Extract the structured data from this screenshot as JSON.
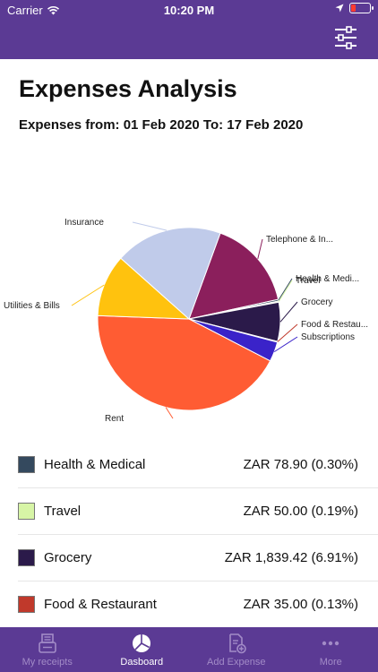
{
  "status_bar": {
    "carrier": "Carrier",
    "time": "10:20 PM"
  },
  "page": {
    "title": "Expenses Analysis",
    "subtitle": "Expenses from: 01 Feb 2020 To: 17 Feb 2020"
  },
  "chart_data": {
    "type": "pie",
    "slices": [
      {
        "label": "Telephone & In...",
        "value": 16.0,
        "color": "#8b1f5c"
      },
      {
        "label": "Health & Medi...",
        "value": 0.3,
        "color": "#34495e"
      },
      {
        "label": "Travel",
        "value": 0.19,
        "color": "#d7f5a6"
      },
      {
        "label": "Grocery",
        "value": 6.91,
        "color": "#2b1a4a"
      },
      {
        "label": "Food & Restau...",
        "value": 0.13,
        "color": "#c0392b"
      },
      {
        "label": "Subscriptions",
        "value": 3.5,
        "color": "#3a23c9"
      },
      {
        "label": "Rent",
        "value": 43.0,
        "color": "#ff5c33"
      },
      {
        "label": "Utilities & Bills",
        "value": 11.0,
        "color": "#ffc20e"
      },
      {
        "label": "Insurance",
        "value": 19.0,
        "color": "#c0cbea"
      }
    ]
  },
  "legend": [
    {
      "label": "Health & Medical",
      "amount": "ZAR 78.90  (0.30%)",
      "color": "#34495e"
    },
    {
      "label": "Travel",
      "amount": "ZAR 50.00  (0.19%)",
      "color": "#d7f5a6"
    },
    {
      "label": "Grocery",
      "amount": "ZAR 1,839.42  (6.91%)",
      "color": "#2b1a4a"
    },
    {
      "label": "Food & Restaurant",
      "amount": "ZAR 35.00  (0.13%)",
      "color": "#c0392b"
    }
  ],
  "tabs": [
    {
      "label": "My receipts",
      "icon": "receipt-icon",
      "active": false
    },
    {
      "label": "Dasboard",
      "icon": "pie-chart-icon",
      "active": true
    },
    {
      "label": "Add Expense",
      "icon": "add-document-icon",
      "active": false
    },
    {
      "label": "More",
      "icon": "more-dots-icon",
      "active": false
    }
  ]
}
